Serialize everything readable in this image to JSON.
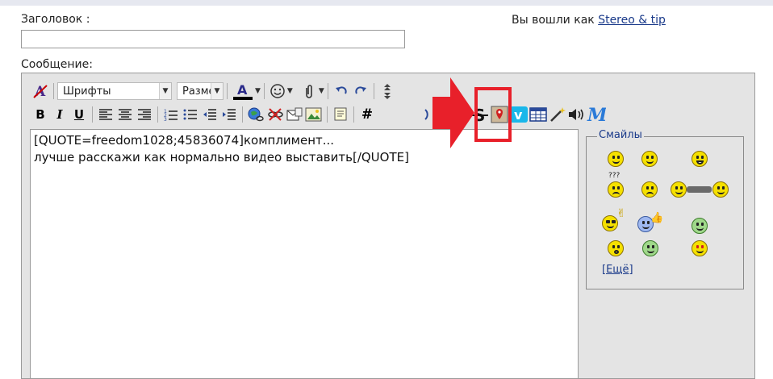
{
  "form": {
    "title_label": "Заголовок :",
    "title_value": "",
    "message_label": "Сообщение:"
  },
  "login": {
    "prefix": "Вы вошли как",
    "username": "Stereo & tip"
  },
  "toolbar": {
    "font_label": "Шрифты",
    "size_label": "Разме"
  },
  "editor": {
    "text": "[QUOTE=freedom1028;45836074]комплимент...\nлучше расскажи как нормально видео выставить[/QUOTE]"
  },
  "smiles": {
    "legend": "Смайлы",
    "more_link": "[Ещё]"
  },
  "annotation": {
    "highlight_color": "#e8202a",
    "highlighted_button": "youtube-button"
  },
  "colors": {
    "link": "#1a3a8a",
    "editor_bg": "#e4e4e4"
  }
}
